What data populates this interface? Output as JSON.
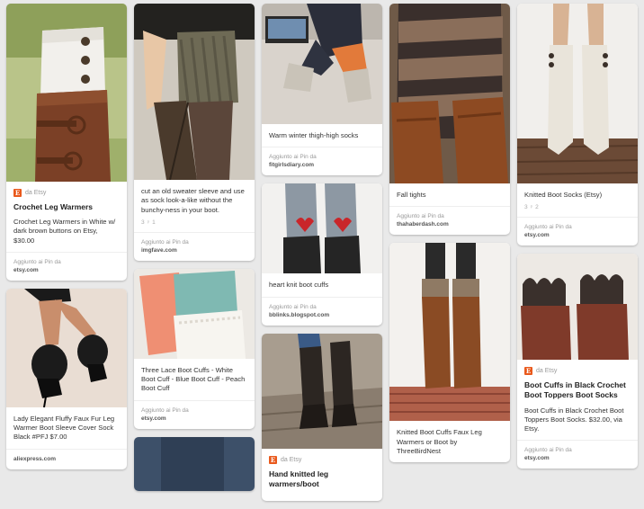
{
  "pins": [
    {
      "source": "da Etsy",
      "title": "Crochet Leg Warmers",
      "description": "Crochet Leg Warmers in White w/ dark brown buttons on Etsy, $30.00",
      "added": "Aggiunto ai Pin da",
      "site": "etsy.com"
    },
    {
      "description": "Lady Elegant Fluffy Faux Fur Leg Warmer Boot Sleeve Cover Sock Black #PFJ $7.00",
      "site": "aliexpress.com"
    },
    {
      "description": "cut an old sweater sleeve and use as sock look-a-like without the bunchy-ness in your boot.",
      "meta": "3 ♀ 1",
      "added": "Aggiunto ai Pin da",
      "site": "imgfave.com"
    },
    {
      "description": "Three Lace Boot Cuffs - White Boot Cuff - Blue Boot Cuff - Peach Boot Cuff",
      "added": "Aggiunto ai Pin da",
      "site": "etsy.com"
    },
    {
      "description": "Warm winter thigh-high socks",
      "added": "Aggiunto ai Pin da",
      "site": "fitgirlsdiary.com"
    },
    {
      "description": "heart knit boot cuffs",
      "added": "Aggiunto ai Pin da",
      "site": "bblinks.blogspot.com"
    },
    {
      "source": "da Etsy",
      "title": "Hand knitted leg warmers/boot"
    },
    {
      "description": "Fall tights",
      "added": "Aggiunto ai Pin da",
      "site": "thahaberdash.com"
    },
    {
      "description": "Knitted Boot Cuffs Faux Leg Warmers or Boot by ThreeBirdNest"
    },
    {
      "description": "Knitted Boot Socks (Etsy)",
      "meta": "3 ♀ 2",
      "added": "Aggiunto ai Pin da",
      "site": "etsy.com"
    },
    {
      "source": "da Etsy",
      "title": "Boot Cuffs in Black Crochet Boot Toppers Boot Socks",
      "description": "Boot Cuffs in Black Crochet Boot Toppers Boot Socks. $32.00, via Etsy.",
      "added": "Aggiunto ai Pin da",
      "site": "etsy.com"
    }
  ],
  "colors": {
    "etsy": "#e9591c",
    "background": "#e9e9e9"
  }
}
